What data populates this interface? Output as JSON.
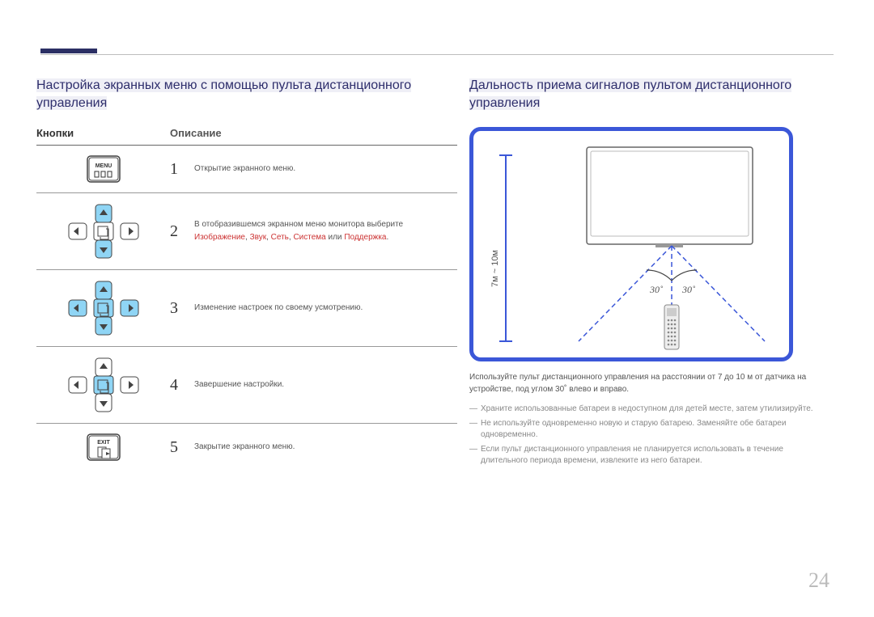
{
  "page_number": "24",
  "left": {
    "heading": "Настройка экранных меню с помощью пульта дистанционного управления",
    "col_buttons": "Кнопки",
    "col_desc": "Описание",
    "rows": [
      {
        "num": "1",
        "desc_plain": "Открытие экранного меню.",
        "icon_menu_label": "MENU"
      },
      {
        "num": "2",
        "desc_before": "В отобразившемся экранном меню монитора выберите ",
        "desc_red1": "Изображение",
        "desc_sep1": ", ",
        "desc_red2": "Звук",
        "desc_sep2": ", ",
        "desc_red3": "Сеть",
        "desc_sep3": ", ",
        "desc_red4": "Система",
        "desc_mid": " или ",
        "desc_red5": "Поддержка",
        "desc_after": "."
      },
      {
        "num": "3",
        "desc_plain": "Изменение настроек по своему усмотрению."
      },
      {
        "num": "4",
        "desc_plain": "Завершение настройки."
      },
      {
        "num": "5",
        "desc_plain": "Закрытие экранного меню.",
        "icon_exit_label": "EXIT"
      }
    ]
  },
  "right": {
    "heading": "Дальность приема сигналов пультом дистанционного управления",
    "diagram": {
      "distance_label": "7м ~ 10м",
      "angle_left": "30˚",
      "angle_right": "30˚"
    },
    "caption": "Используйте пульт дистанционного управления на расстоянии от 7 до 10 м от датчика на устройстве, под углом 30˚ влево и вправо.",
    "notes": [
      "Храните использованные батареи в недоступном для детей месте, затем утилизируйте.",
      "Не используйте одновременно новую и старую батарею. Заменяйте обе батареи одновременно.",
      "Если пульт дистанционного управления не планируется использовать в течение длительного периода времени, извлеките из него батареи."
    ]
  }
}
